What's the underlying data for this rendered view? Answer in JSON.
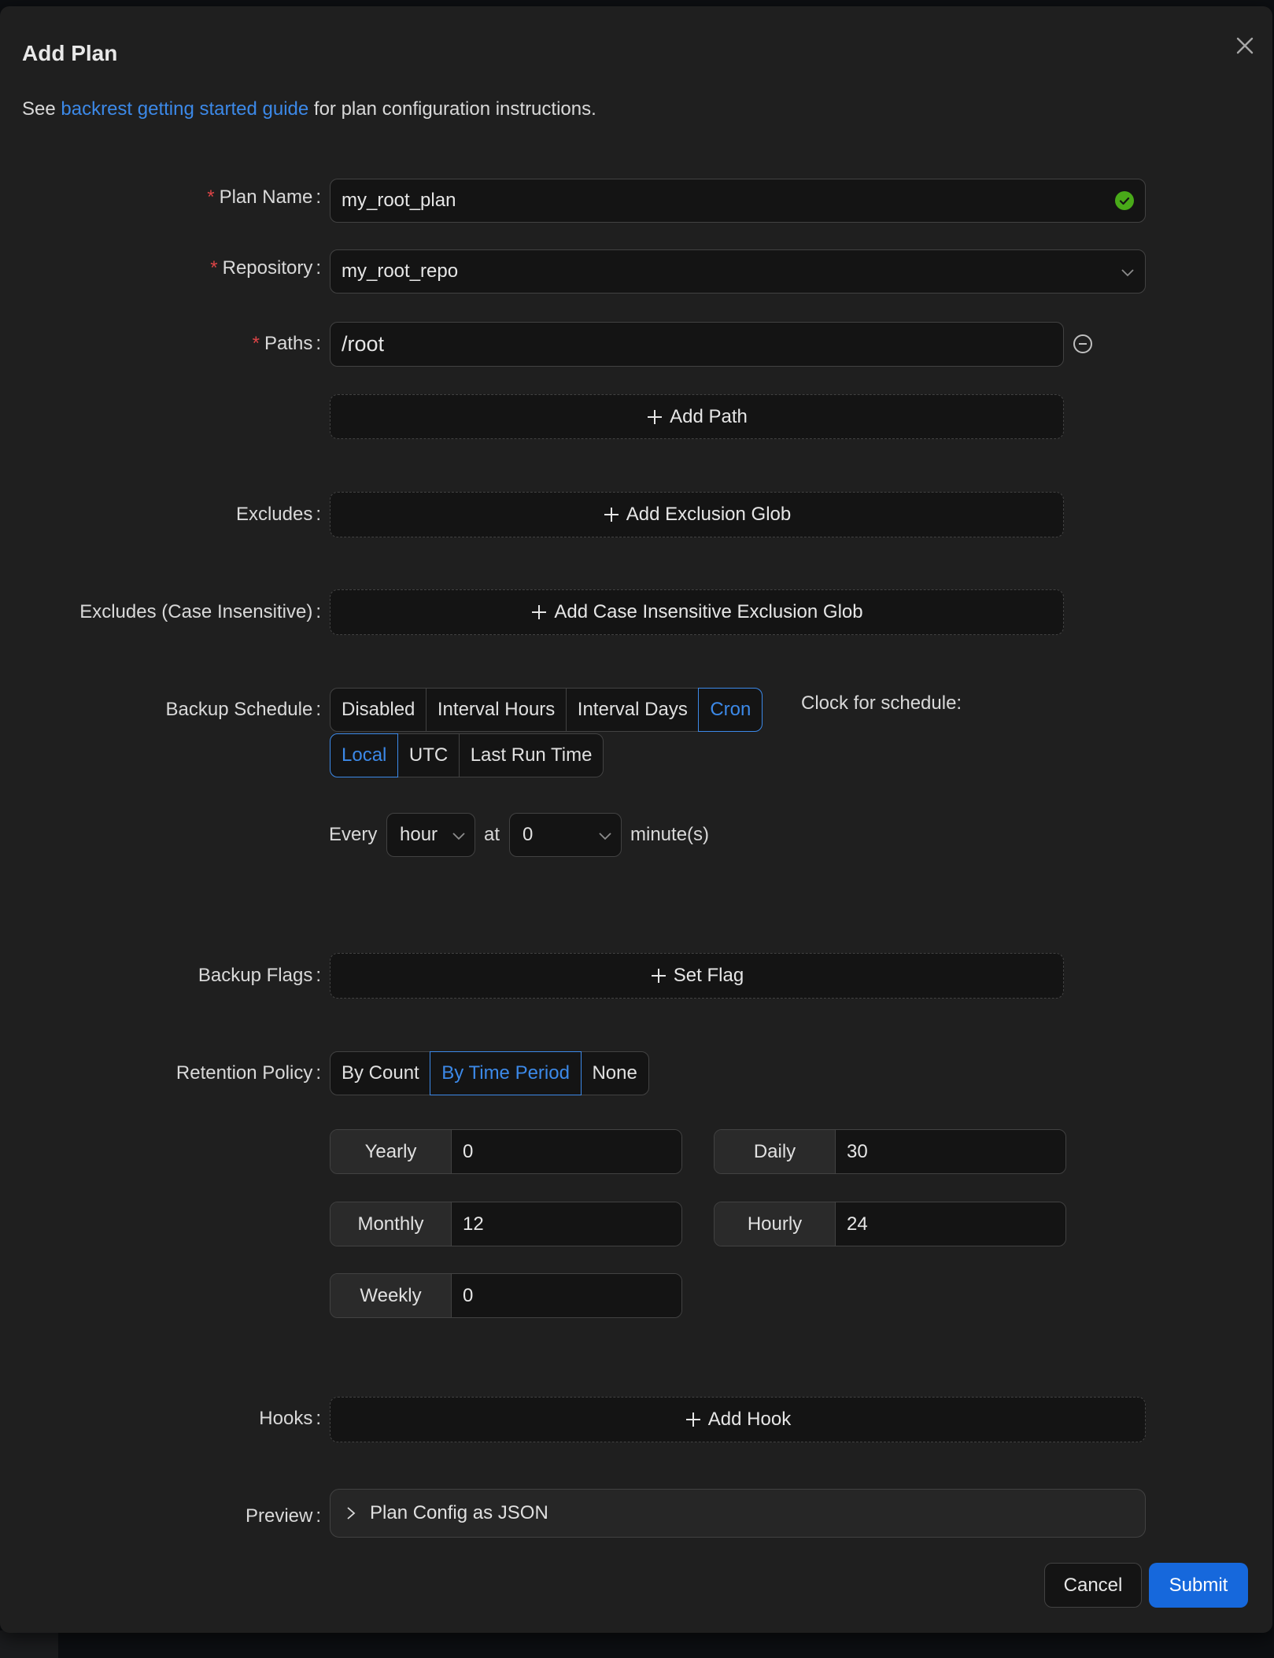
{
  "modal": {
    "title": "Add Plan",
    "intro_prefix": "See ",
    "intro_link": "backrest getting started guide",
    "intro_suffix": " for plan configuration instructions."
  },
  "form": {
    "plan_name": {
      "label": "Plan Name",
      "value": "my_root_plan",
      "required": true,
      "status": "valid"
    },
    "repository": {
      "label": "Repository",
      "value": "my_root_repo",
      "required": true
    },
    "paths": {
      "label": "Paths",
      "values": [
        "/root"
      ],
      "add_label": "Add Path",
      "required": true
    },
    "excludes": {
      "label": "Excludes",
      "add_label": "Add Exclusion Glob"
    },
    "iexcludes": {
      "label": "Excludes (Case Insensitive)",
      "add_label": "Add Case Insensitive Exclusion Glob"
    },
    "schedule": {
      "label": "Backup Schedule",
      "modes": [
        "Disabled",
        "Interval Hours",
        "Interval Days",
        "Cron"
      ],
      "active_mode": "Cron",
      "clock_label": "Clock for schedule:",
      "clocks": [
        "Local",
        "UTC",
        "Last Run Time"
      ],
      "active_clock": "Local",
      "every_label": "Every",
      "every_value": "hour",
      "at_label": "at",
      "minute_value": "0",
      "minute_suffix": "minute(s)"
    },
    "flags": {
      "label": "Backup Flags",
      "add_label": "Set Flag"
    },
    "retention": {
      "label": "Retention Policy",
      "modes": [
        "By Count",
        "By Time Period",
        "None"
      ],
      "active_mode": "By Time Period",
      "yearly": {
        "label": "Yearly",
        "value": "0"
      },
      "daily": {
        "label": "Daily",
        "value": "30"
      },
      "monthly": {
        "label": "Monthly",
        "value": "12"
      },
      "hourly": {
        "label": "Hourly",
        "value": "24"
      },
      "weekly": {
        "label": "Weekly",
        "value": "0"
      }
    },
    "hooks": {
      "label": "Hooks",
      "add_label": "Add Hook"
    },
    "preview": {
      "label": "Preview",
      "collapse_label": "Plan Config as JSON"
    }
  },
  "footer": {
    "cancel_label": "Cancel",
    "submit_label": "Submit"
  },
  "colors": {
    "accent": "#3c89e8",
    "primary_button": "#1668dc",
    "required_mark": "#dc4446",
    "success": "#49aa19"
  },
  "icons": {
    "close": "close-icon",
    "valid": "check-circle-icon",
    "select": "chevron-down-icon",
    "remove": "minus-circle-icon",
    "add": "plus-icon",
    "expand": "chevron-right-icon"
  }
}
